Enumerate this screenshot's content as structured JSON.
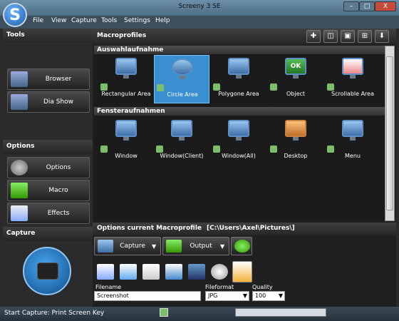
{
  "window": {
    "title": "Screeny 3 SE",
    "logo_letter": "S",
    "minimize": "–",
    "maximize": "□",
    "close": "X"
  },
  "menu": [
    "File",
    "View",
    "Capture",
    "Tools",
    "Settings",
    "Help"
  ],
  "sidebar": {
    "tools_title": "Tools",
    "tools": [
      "Browser",
      "Dia Show"
    ],
    "options_title": "Options",
    "options": [
      "Options",
      "Macro",
      "Effects"
    ],
    "capture_title": "Capture"
  },
  "macroprofiles": {
    "title": "Macroprofiles",
    "toolbar_icons": [
      "add-icon",
      "refresh-icon",
      "save-icon",
      "grid-icon",
      "download-icon"
    ],
    "toolbar_glyphs": [
      "✚",
      "◫",
      "▣",
      "⊞",
      "⬇"
    ],
    "group1": "Auswahlaufnahme",
    "group1_items": [
      "Rectangular Area",
      "Circle Area",
      "Polygone Area",
      "Object",
      "Scrollable Area"
    ],
    "object_badge": "OK",
    "group2": "Fensteraufnahmen",
    "group2_items": [
      "Window",
      "Window(Client)",
      "Window(All)",
      "Desktop",
      "Menu"
    ]
  },
  "options_current": {
    "title": "Options current Macroprofile",
    "path": "[C:\\Users\\Axel\\Pictures\\]",
    "capture_label": "Capture",
    "output_label": "Output",
    "filename_label": "Filename",
    "filename_value": "Screenshot",
    "fileformat_label": "Fileformat",
    "fileformat_value": "JPG",
    "quality_label": "Quality",
    "quality_value": "100"
  },
  "status": {
    "text": "Start Capture: Print Screen Key"
  },
  "colors": {
    "selection": "#3a8fd0",
    "accent": "#5c8fc6"
  }
}
